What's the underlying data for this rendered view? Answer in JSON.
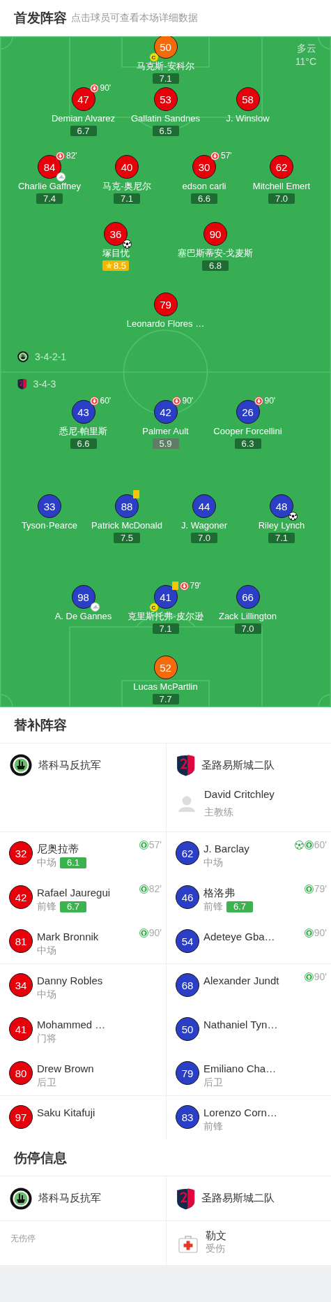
{
  "lineup_header": {
    "title": "首发阵容",
    "subtitle": "点击球员可查看本场详细数据"
  },
  "pitch": {
    "weather": {
      "condition": "多云",
      "temperature": "11°C"
    },
    "home": {
      "formation": "3-4-2-1",
      "lines": [
        {
          "players": [
            {
              "number": "50",
              "name": "马克斯-安科尔",
              "color": "#f56a0a",
              "rating": {
                "value": "7.1",
                "kind": "normal"
              },
              "events": [
                {
                  "kind": "captain",
                  "label": "C"
                }
              ]
            }
          ]
        },
        {
          "players": [
            {
              "number": "47",
              "name": "Demian Alvarez",
              "color": "#e8000b",
              "rating": {
                "value": "6.7",
                "kind": "normal"
              },
              "events": [
                {
                  "kind": "sub_off",
                  "minute": "90'"
                }
              ]
            },
            {
              "number": "53",
              "name": "Gallatin Sandnes",
              "color": "#e8000b",
              "rating": {
                "value": "6.5",
                "kind": "normal"
              }
            },
            {
              "number": "58",
              "name": "J. Winslow",
              "color": "#e8000b"
            }
          ]
        },
        {
          "players": [
            {
              "number": "84",
              "name": "Charlie Gaffney",
              "color": "#e8000b",
              "rating": {
                "value": "7.4",
                "kind": "normal"
              },
              "events": [
                {
                  "kind": "sub_off",
                  "minute": "82'"
                },
                {
                  "kind": "assist"
                }
              ]
            },
            {
              "number": "40",
              "name": "马克-奥尼尔",
              "color": "#e8000b",
              "rating": {
                "value": "7.1",
                "kind": "normal"
              }
            },
            {
              "number": "30",
              "name": "edson carli",
              "color": "#e8000b",
              "rating": {
                "value": "6.6",
                "kind": "normal"
              },
              "events": [
                {
                  "kind": "sub_off",
                  "minute": "57'"
                }
              ]
            },
            {
              "number": "62",
              "name": "Mitchell Emert",
              "color": "#e8000b",
              "rating": {
                "value": "7.0",
                "kind": "normal"
              }
            }
          ]
        },
        {
          "players": [
            {
              "number": "36",
              "name": "塚目忧",
              "color": "#e8000b",
              "rating": {
                "value": "8.5",
                "kind": "best"
              },
              "events": [
                {
                  "kind": "goal"
                }
              ]
            },
            {
              "number": "90",
              "name": "塞巴斯蒂安-戈麦斯",
              "color": "#e8000b",
              "rating": {
                "value": "6.8",
                "kind": "normal"
              }
            }
          ]
        },
        {
          "players": [
            {
              "number": "79",
              "name": "Leonardo Flores …",
              "color": "#e8000b"
            }
          ]
        }
      ]
    },
    "away": {
      "formation": "3-4-3",
      "lines": [
        {
          "players": [
            {
              "number": "43",
              "name": "悉尼-帕里斯",
              "color": "#2a3fc6",
              "rating": {
                "value": "6.6",
                "kind": "normal"
              },
              "events": [
                {
                  "kind": "sub_off",
                  "minute": "60'"
                }
              ]
            },
            {
              "number": "42",
              "name": "Palmer Ault",
              "color": "#2a3fc6",
              "rating": {
                "value": "5.9",
                "kind": "low"
              },
              "events": [
                {
                  "kind": "sub_off",
                  "minute": "90'"
                }
              ]
            },
            {
              "number": "26",
              "name": "Cooper Forcellini",
              "color": "#2a3fc6",
              "rating": {
                "value": "6.3",
                "kind": "normal"
              },
              "events": [
                {
                  "kind": "sub_off",
                  "minute": "90'"
                }
              ]
            }
          ]
        },
        {
          "players": [
            {
              "number": "33",
              "name": "Tyson·Pearce",
              "color": "#2a3fc6"
            },
            {
              "number": "88",
              "name": "Patrick McDonald",
              "color": "#2a3fc6",
              "rating": {
                "value": "7.5",
                "kind": "normal"
              },
              "events": [
                {
                  "kind": "yellow_card"
                }
              ]
            },
            {
              "number": "44",
              "name": "J. Wagoner",
              "color": "#2a3fc6",
              "rating": {
                "value": "7.0",
                "kind": "normal"
              }
            },
            {
              "number": "48",
              "name": "Riley Lynch",
              "color": "#2a3fc6",
              "rating": {
                "value": "7.1",
                "kind": "normal"
              },
              "events": [
                {
                  "kind": "goal"
                }
              ]
            }
          ]
        },
        {
          "players": [
            {
              "number": "98",
              "name": "A. De Gannes",
              "color": "#2a3fc6",
              "events": [
                {
                  "kind": "assist"
                }
              ]
            },
            {
              "number": "41",
              "name": "克里斯托弗-皮尔逊",
              "color": "#2a3fc6",
              "rating": {
                "value": "7.1",
                "kind": "normal"
              },
              "events": [
                {
                  "kind": "yellow_card"
                },
                {
                  "kind": "sub_off",
                  "minute": "79'"
                },
                {
                  "kind": "captain",
                  "label": "C"
                }
              ]
            },
            {
              "number": "66",
              "name": "Zack Lillington",
              "color": "#2a3fc6",
              "rating": {
                "value": "7.0",
                "kind": "normal"
              }
            }
          ]
        },
        {
          "players": [
            {
              "number": "52",
              "name": "Lucas McPartlin",
              "color": "#f56a0a",
              "rating": {
                "value": "7.7",
                "kind": "normal"
              }
            }
          ]
        }
      ]
    }
  },
  "subs": {
    "title": "替补阵容",
    "home": {
      "team": "塔科马反抗军",
      "color": "#e8000b",
      "players": [
        {
          "number": "32",
          "name": "尼奥拉蒂",
          "position": "中场",
          "rating": "6.1",
          "events": [
            {
              "kind": "sub_on",
              "minute": "57'"
            }
          ]
        },
        {
          "number": "42",
          "name": "Rafael Jauregui",
          "position": "前锋",
          "rating": "6.7",
          "events": [
            {
              "kind": "sub_on",
              "minute": "82'"
            }
          ]
        },
        {
          "number": "81",
          "name": "Mark Bronnik",
          "position": "中场",
          "events": [
            {
              "kind": "sub_on",
              "minute": "90'"
            }
          ]
        },
        {
          "number": "34",
          "name": "Danny Robles",
          "position": "中场"
        },
        {
          "number": "41",
          "name": "Mohammed …",
          "position": "门将"
        },
        {
          "number": "80",
          "name": "Drew Brown",
          "position": "后卫"
        },
        {
          "number": "97",
          "name": "Saku Kitafuji"
        }
      ]
    },
    "away": {
      "team": "圣路易斯城二队",
      "color": "#2a3fc6",
      "coach": {
        "name": "David Critchley",
        "role": "主教练"
      },
      "players": [
        {
          "number": "62",
          "name": "J. Barclay",
          "position": "中场",
          "events": [
            {
              "kind": "goal"
            },
            {
              "kind": "sub_on",
              "minute": "60'"
            }
          ]
        },
        {
          "number": "46",
          "name": "格洛弗",
          "position": "前锋",
          "rating": "6.7",
          "events": [
            {
              "kind": "sub_on",
              "minute": "79'"
            }
          ]
        },
        {
          "number": "54",
          "name": "Adeteye Gba…",
          "events": [
            {
              "kind": "sub_on",
              "minute": "90'"
            }
          ]
        },
        {
          "number": "68",
          "name": "Alexander Jundt",
          "events": [
            {
              "kind": "sub_on",
              "minute": "90'"
            }
          ]
        },
        {
          "number": "50",
          "name": "Nathaniel Tyn…"
        },
        {
          "number": "79",
          "name": "Emiliano Cha…",
          "position": "后卫"
        },
        {
          "number": "83",
          "name": "Lorenzo Corn…",
          "position": "前锋"
        }
      ]
    }
  },
  "injuries": {
    "title": "伤停信息",
    "home": {
      "team": "塔科马反抗军",
      "empty_text": "无伤停"
    },
    "away": {
      "team": "圣路易斯城二队",
      "players": [
        {
          "name": "勒文",
          "status": "受伤"
        }
      ]
    }
  }
}
